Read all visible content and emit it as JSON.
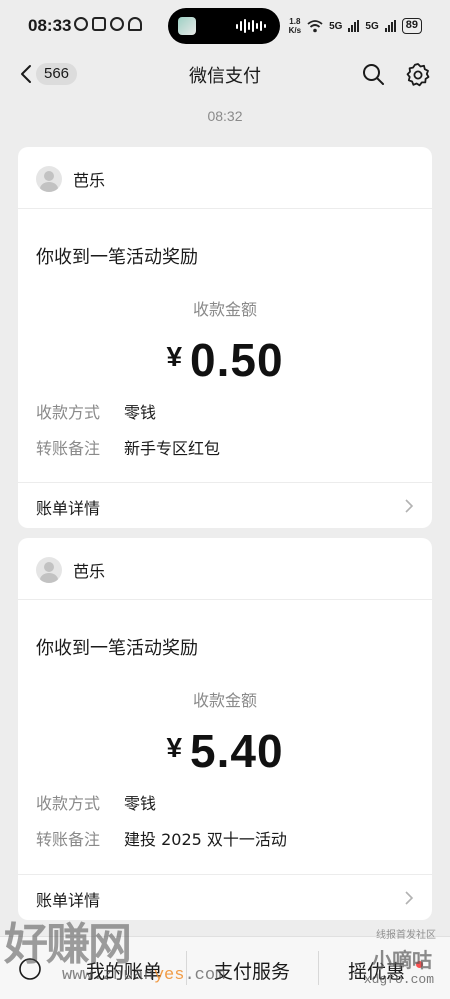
{
  "status_bar": {
    "time": "08:33",
    "net_speed_value": "1.8",
    "net_speed_unit": "K/s",
    "network_1": "5G",
    "network_2": "5G",
    "battery": "89"
  },
  "nav": {
    "back_count": "566",
    "title": "微信支付"
  },
  "timestamp": "08:32",
  "cards": [
    {
      "sender": "芭乐",
      "title": "你收到一笔活动奖励",
      "amount_label": "收款金额",
      "currency": "¥",
      "amount": "0.50",
      "payment_method_label": "收款方式",
      "payment_method": "零钱",
      "remark_label": "转账备注",
      "remark": "新手专区红包",
      "footer": "账单详情"
    },
    {
      "sender": "芭乐",
      "title": "你收到一笔活动奖励",
      "amount_label": "收款金额",
      "currency": "¥",
      "amount": "5.40",
      "payment_method_label": "收款方式",
      "payment_method": "零钱",
      "remark_label": "转账备注",
      "remark": "建投 2025 双十一活动",
      "footer": "账单详情"
    }
  ],
  "bottom_bar": {
    "tab_1": "我的账单",
    "tab_2": "支付服务",
    "tab_3": "摇优惠"
  },
  "watermark": {
    "logo": "好赚网",
    "url_prefix": "www.zhuan",
    "url_accent": "yes",
    "url_suffix": ".com",
    "forum": "线报首发社区",
    "brand": "小嘀咕",
    "brand_url": "xdgfo.com"
  },
  "colors": {
    "background": "#ededed",
    "card": "#ffffff",
    "secondary_text": "#8a8a8a",
    "badge": "#fa5151"
  }
}
